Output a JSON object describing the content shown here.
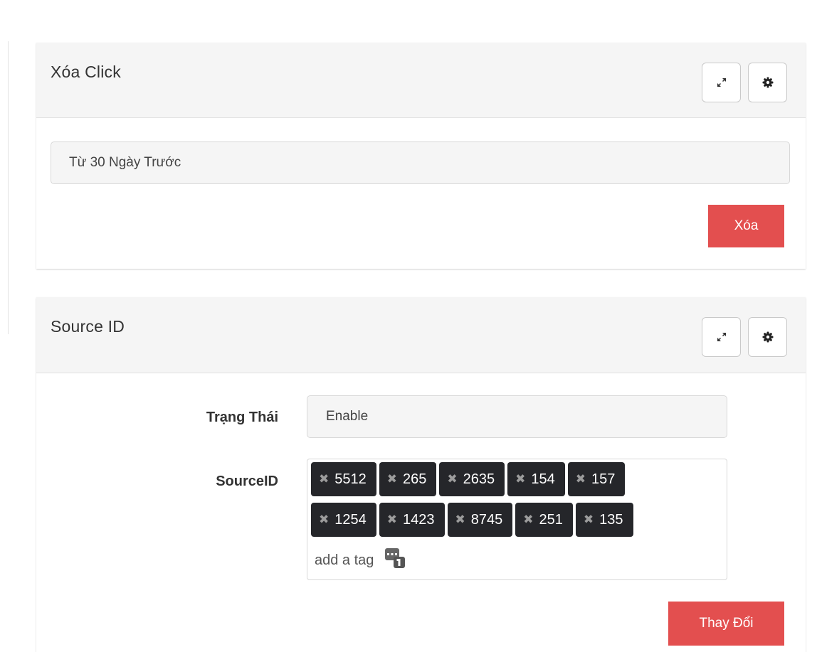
{
  "clear_panel": {
    "title": "Xóa Click",
    "expand_icon": "expand-arrows-icon",
    "settings_icon": "gear-icon",
    "range_value": "Từ 30 Ngày Trước",
    "delete_label": "Xóa",
    "delete_color": "#e34f4f"
  },
  "source_panel": {
    "title": "Source ID",
    "expand_icon": "expand-arrows-icon",
    "settings_icon": "gear-icon",
    "status_label": "Trạng Thái",
    "status_value": "Enable",
    "sourceid_label": "SourceID",
    "tags_row1": [
      "5512",
      "265",
      "2635",
      "154",
      "157"
    ],
    "tags_row2": [
      "1254",
      "1423",
      "8745",
      "251",
      "135"
    ],
    "tag_remove_glyph": "✖",
    "tag_color": "#25262a",
    "add_tag_placeholder": "add a tag",
    "change_label": "Thay Đổi",
    "change_color": "#e34f4f"
  }
}
